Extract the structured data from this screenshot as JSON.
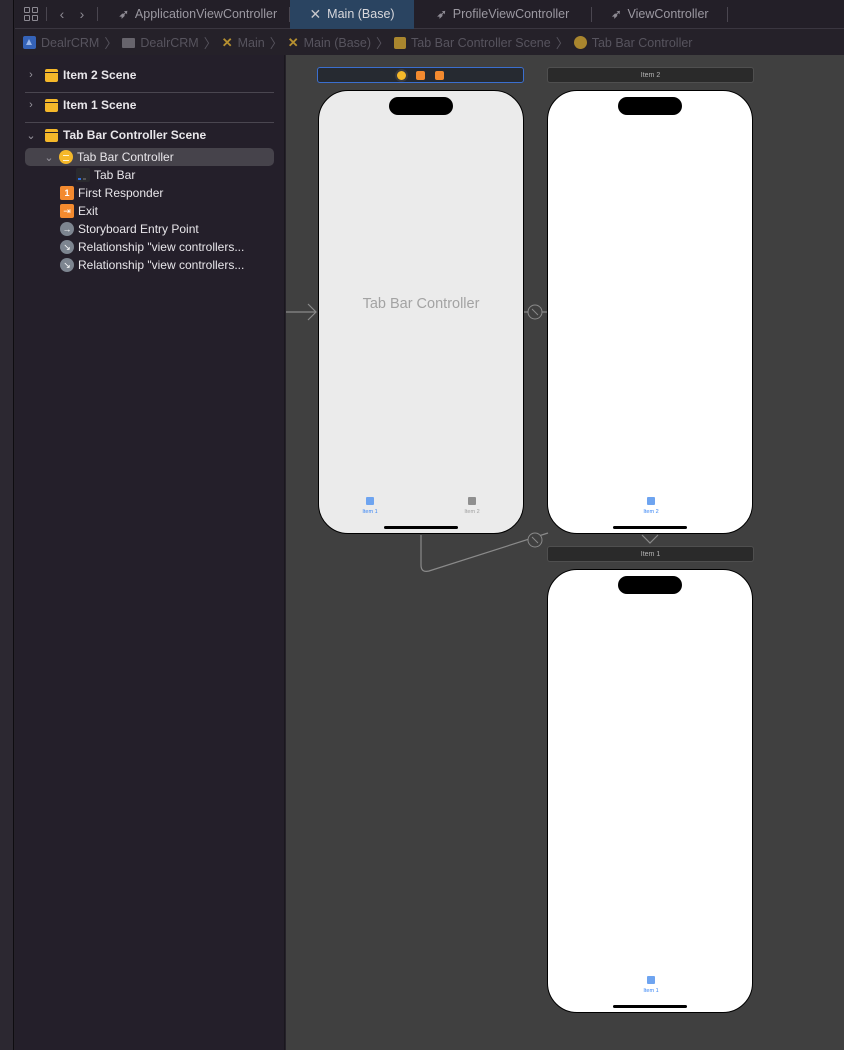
{
  "tabbar": {
    "tabs": [
      {
        "label": "ApplicationViewController",
        "icon": "swift-icon",
        "active": false
      },
      {
        "label": "Main (Base)",
        "icon": "storyboard-icon",
        "active": true
      },
      {
        "label": "ProfileViewController",
        "icon": "swift-icon",
        "active": false
      },
      {
        "label": "ViewController",
        "icon": "swift-icon",
        "active": false
      }
    ],
    "nav_back": "‹",
    "nav_forward": "›"
  },
  "breadcrumb": [
    {
      "label": "DealrCRM",
      "icon": "project-icon"
    },
    {
      "label": "DealrCRM",
      "icon": "folder-icon"
    },
    {
      "label": "Main",
      "icon": "storyboard-icon"
    },
    {
      "label": "Main (Base)",
      "icon": "storyboard-icon"
    },
    {
      "label": "Tab Bar Controller Scene",
      "icon": "scene-icon"
    },
    {
      "label": "Tab Bar Controller",
      "icon": "tab-bar-controller-icon"
    }
  ],
  "outline": {
    "scenes": [
      {
        "label": "Item 2 Scene",
        "expanded": false
      },
      {
        "label": "Item 1 Scene",
        "expanded": false
      },
      {
        "label": "Tab Bar Controller Scene",
        "expanded": true
      }
    ],
    "nodes": [
      {
        "label": "Tab Bar Controller",
        "icon": "tab-bar-controller-icon",
        "selected": true,
        "expanded": true
      },
      {
        "label": "Tab Bar",
        "icon": "tab-bar-icon"
      },
      {
        "label": "First Responder",
        "icon": "first-responder-icon",
        "glyph": "1"
      },
      {
        "label": "Exit",
        "icon": "exit-icon",
        "glyph": "⇥"
      },
      {
        "label": "Storyboard Entry Point",
        "icon": "entry-point-icon",
        "glyph": "→"
      },
      {
        "label": "Relationship \"view controllers...",
        "icon": "relationship-icon",
        "glyph": "↘"
      },
      {
        "label": "Relationship \"view controllers...",
        "icon": "relationship-icon",
        "glyph": "↘"
      }
    ]
  },
  "canvas": {
    "tab_bar_controller": {
      "title": "Tab Bar Controller",
      "tabs": [
        {
          "label": "Item 1",
          "selected": true
        },
        {
          "label": "Item 2",
          "selected": false
        }
      ]
    },
    "item2_scene": {
      "header": "Item 2",
      "tab_label": "Item 2"
    },
    "item1_scene": {
      "header": "Item 1",
      "tab_label": "Item 1"
    }
  },
  "colors": {
    "accent_blue": "#3a86f5",
    "selected_tab_bg": "#2a4461",
    "scene_icon": "#f5b82a",
    "first_responder": "#f38a2f",
    "canvas_bg": "#404040"
  }
}
